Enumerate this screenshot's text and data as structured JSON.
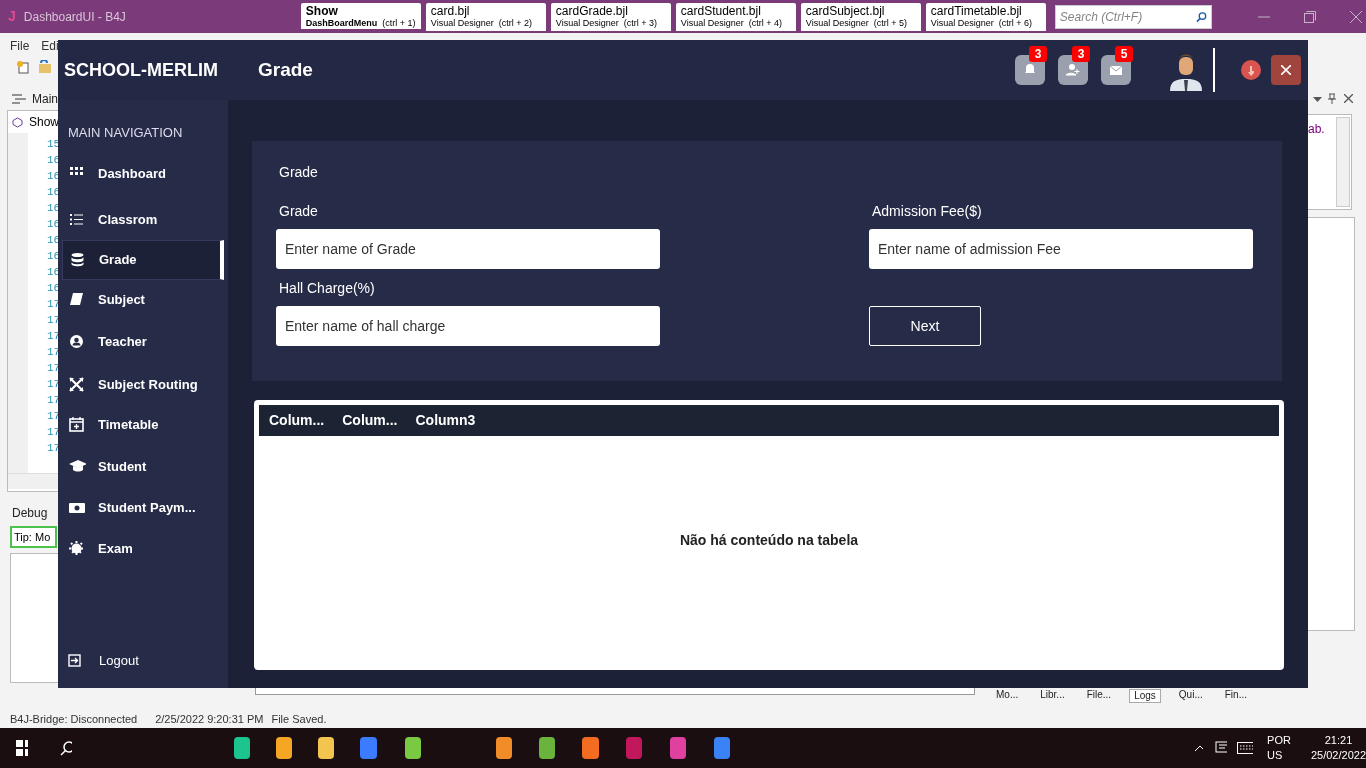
{
  "ide": {
    "logo": "J",
    "title": "DashboardUI - B4J",
    "tabs": [
      {
        "title": "Show",
        "subtitle": "DashBoardMenu",
        "shortcut": "(ctrl + 1)",
        "selected": true
      },
      {
        "title": "card.bjl",
        "subtitle": "Visual Designer",
        "shortcut": "(ctrl + 2)",
        "selected": false
      },
      {
        "title": "cardGrade.bjl",
        "subtitle": "Visual Designer",
        "shortcut": "(ctrl + 3)",
        "selected": false
      },
      {
        "title": "cardStudent.bjl",
        "subtitle": "Visual Designer",
        "shortcut": "(ctrl + 4)",
        "selected": false
      },
      {
        "title": "cardSubject.bjl",
        "subtitle": "Visual Designer",
        "shortcut": "(ctrl + 5)",
        "selected": false
      },
      {
        "title": "cardTimetable.bjl",
        "subtitle": "Visual Designer",
        "shortcut": "(ctrl + 6)",
        "selected": false
      }
    ],
    "search": {
      "placeholder": "Search (Ctrl+F)"
    },
    "menu": [
      "File",
      "Edi"
    ],
    "main_label": "Main",
    "module_tab": "Show",
    "line_numbers": [
      "15",
      "16",
      "16",
      "16",
      "16",
      "16",
      "16",
      "16",
      "16",
      "16",
      "17",
      "17",
      "17",
      "17",
      "17",
      "17",
      "17",
      "17",
      "17",
      "17"
    ],
    "debug_tab": "Debug",
    "tip": "Tip: Mo",
    "right_text": "ab.",
    "bottom_tabs": [
      {
        "label": "Mo...",
        "selected": false
      },
      {
        "label": "Libr...",
        "selected": false
      },
      {
        "label": "File...",
        "selected": false
      },
      {
        "label": "Logs",
        "selected": true
      },
      {
        "label": "Qui...",
        "selected": false
      },
      {
        "label": "Fin...",
        "selected": false
      }
    ],
    "status_bar": [
      "B4J-Bridge: Disconnected",
      "2/25/2022 9:20:31 PM",
      "File Saved."
    ]
  },
  "app": {
    "brand": "SCHOOL-MERLIM",
    "page_title": "Grade",
    "badges": [
      "3",
      "3",
      "5"
    ],
    "nav_heading": "MAIN NAVIGATION",
    "nav": [
      {
        "label": "Dashboard",
        "selected": false
      },
      {
        "label": "Classrom",
        "selected": false
      },
      {
        "label": "Grade",
        "selected": true
      },
      {
        "label": "Subject",
        "selected": false
      },
      {
        "label": "Teacher",
        "selected": false
      },
      {
        "label": "Subject Routing",
        "selected": false
      },
      {
        "label": "Timetable",
        "selected": false
      },
      {
        "label": "Student",
        "selected": false
      },
      {
        "label": "Student Paym...",
        "selected": false
      },
      {
        "label": "Exam",
        "selected": false
      }
    ],
    "logout": "Logout",
    "form": {
      "title": "Grade",
      "fields": [
        {
          "label": "Grade",
          "placeholder": "Enter name of Grade"
        },
        {
          "label": "Admission Fee($)",
          "placeholder": "Enter name of admission Fee"
        },
        {
          "label": "Hall Charge(%)",
          "placeholder": "Enter name of hall charge"
        }
      ],
      "button": "Next"
    },
    "table": {
      "columns": [
        "Colum...",
        "Colum...",
        "Column3"
      ],
      "empty_message": "Não há conteúdo na tabela"
    }
  },
  "taskbar": {
    "language": "POR",
    "layout": "US",
    "time": "21:21",
    "date": "25/02/2022"
  }
}
